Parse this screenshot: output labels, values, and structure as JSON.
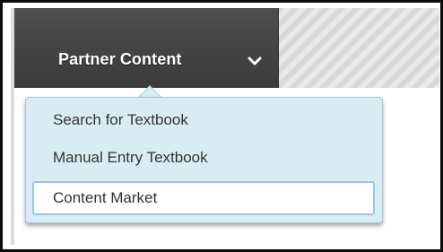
{
  "nav": {
    "tab_label": "Partner Content",
    "tab_icon": "chevron-down-icon"
  },
  "dropdown": {
    "items": [
      {
        "label": "Search for Textbook"
      },
      {
        "label": "Manual Entry Textbook"
      },
      {
        "label": "Content Market"
      }
    ],
    "highlighted_index": 2
  },
  "colors": {
    "tab_background": "#444444",
    "menu_background": "#d9ecf3",
    "highlight_border": "#9cc3ee",
    "text": "#333333"
  }
}
